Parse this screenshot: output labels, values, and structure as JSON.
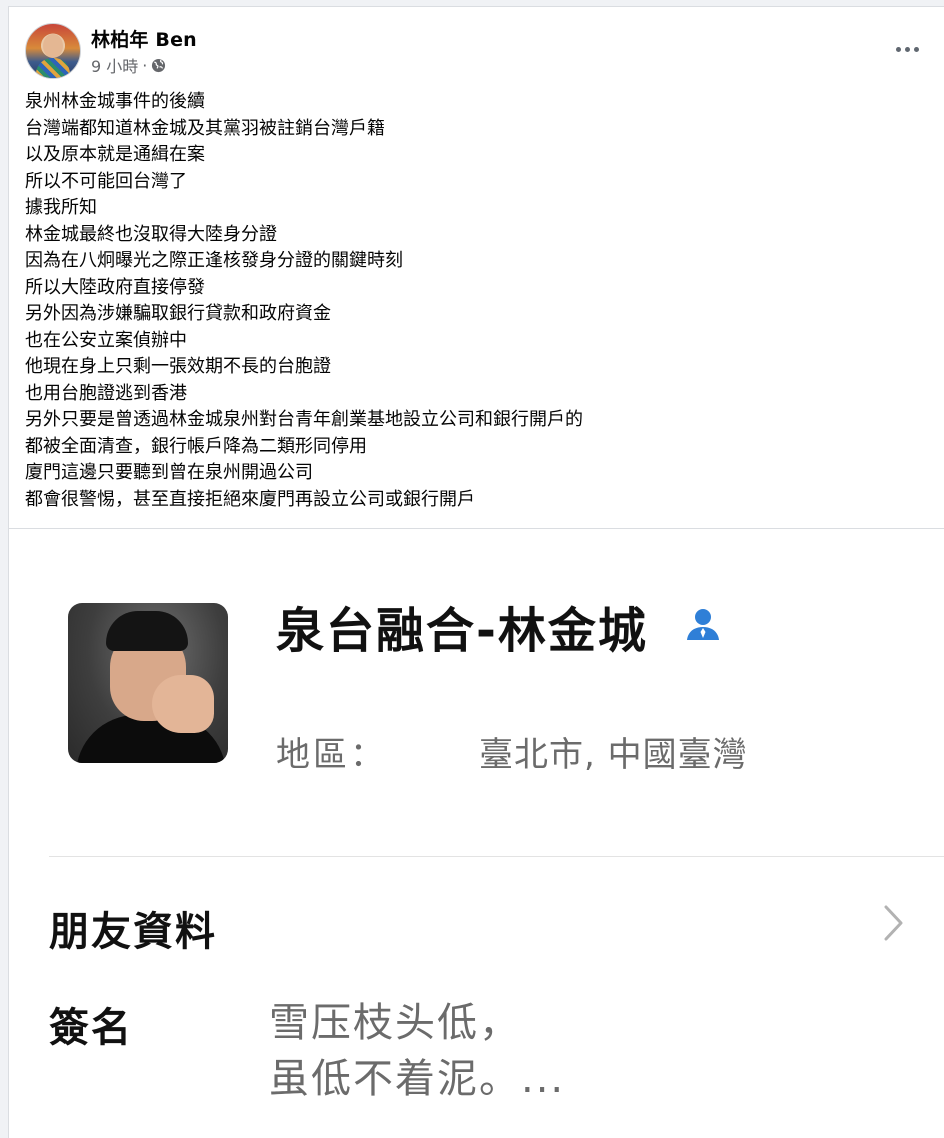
{
  "post": {
    "author": "林柏年 Ben",
    "time": "9 小時",
    "separator": "·",
    "privacy_icon": "globe-icon",
    "more_icon": "more-options-icon",
    "text_lines": [
      "泉州林金城事件的後續",
      "台灣端都知道林金城及其黨羽被註銷台灣戶籍",
      "以及原本就是通緝在案",
      "所以不可能回台灣了",
      "據我所知",
      "林金城最終也沒取得大陸身分證",
      "因為在八炯曝光之際正逢核發身分證的關鍵時刻",
      "所以大陸政府直接停發",
      "另外因為涉嫌騙取銀行貸款和政府資金",
      "也在公安立案偵辦中",
      "他現在身上只剩一張效期不長的台胞證",
      "也用台胞證逃到香港",
      "另外只要是曾透過林金城泉州對台青年創業基地設立公司和銀行開戶的",
      "都被全面清查，銀行帳戶降為二類形同停用",
      "廈門這邊只要聽到曾在泉州開過公司",
      "都會很警惕，甚至直接拒絕來廈門再設立公司或銀行開戶"
    ]
  },
  "screenshot": {
    "contact_name": "泉台融合-林金城",
    "contact_icon": "person-icon",
    "region_label": "地區：",
    "region_value": "臺北市, 中國臺灣",
    "friend_info_label": "朋友資料",
    "chevron_icon": "chevron-right-icon",
    "signature_label": "簽名",
    "signature_lines": [
      "雪压枝头低，",
      "虽低不着泥。..."
    ],
    "accent_color": "#2f7fd7"
  }
}
